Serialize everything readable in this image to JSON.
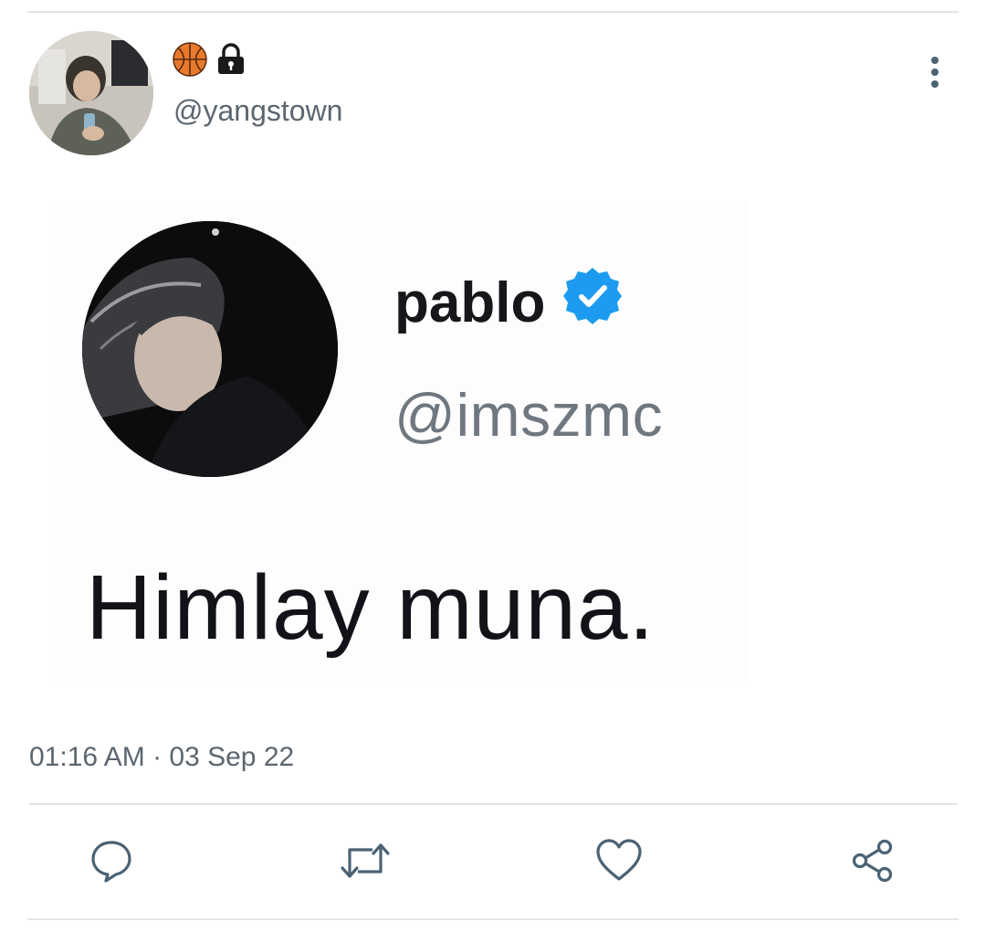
{
  "tweet": {
    "author": {
      "display_emojis": [
        "basketball-emoji",
        "lock-icon"
      ],
      "handle": "@yangstown"
    },
    "embedded_tweet": {
      "name": "pablo",
      "verified": true,
      "handle": "@imszmc",
      "text": "Himlay muna."
    },
    "timestamp": "01:16 AM · 03 Sep 22",
    "actions": [
      {
        "name": "reply",
        "icon": "speech-bubble-icon"
      },
      {
        "name": "retweet",
        "icon": "retweet-icon"
      },
      {
        "name": "like",
        "icon": "heart-icon"
      },
      {
        "name": "share",
        "icon": "share-icon"
      }
    ],
    "colors": {
      "verified_blue": "#1d9bf0",
      "secondary_text": "#5b6670",
      "icon_gray": "#4a6274",
      "divider": "#e3e5e8"
    }
  }
}
